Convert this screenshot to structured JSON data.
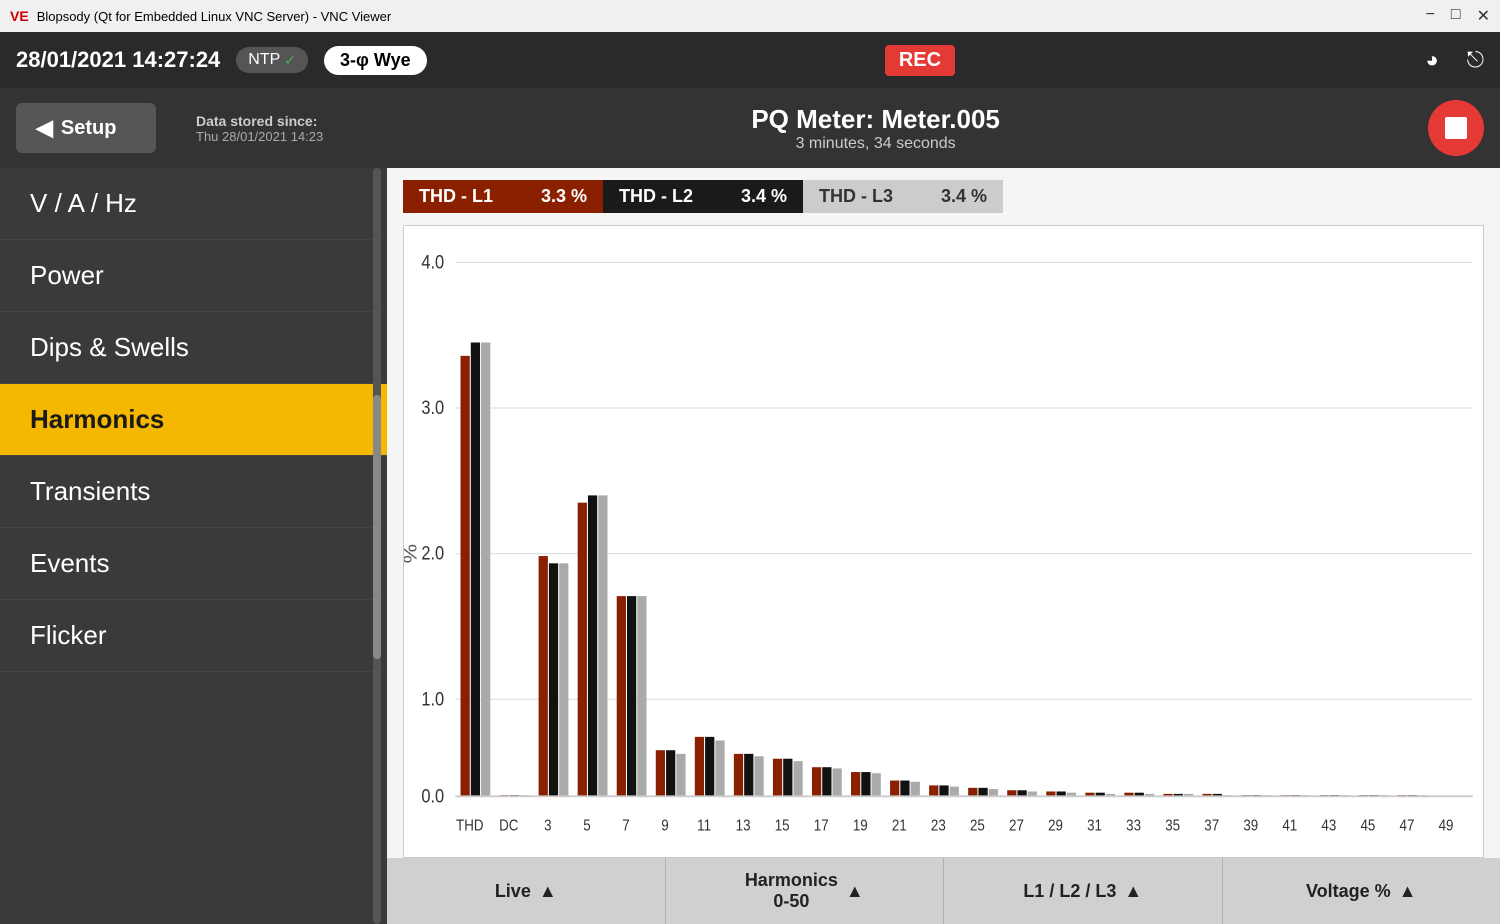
{
  "titlebar": {
    "title": "Blopsody (Qt for Embedded Linux VNC Server) - VNC Viewer",
    "icon_label": "VE"
  },
  "topbar": {
    "datetime": "28/01/2021  14:27:24",
    "ntp_label": "NTP",
    "wye_label": "3-φ Wye",
    "rec_label": "REC"
  },
  "headerbar": {
    "setup_label": "Setup",
    "meter_title": "PQ Meter: Meter.005",
    "data_stored_label": "Data stored since:",
    "data_stored_date": "Thu 28/01/2021 14:23",
    "duration": "3 minutes, 34 seconds"
  },
  "sidebar": {
    "items": [
      {
        "label": "V / A / Hz",
        "active": false
      },
      {
        "label": "Power",
        "active": false
      },
      {
        "label": "Dips & Swells",
        "active": false
      },
      {
        "label": "Harmonics",
        "active": true
      },
      {
        "label": "Transients",
        "active": false
      },
      {
        "label": "Events",
        "active": false
      },
      {
        "label": "Flicker",
        "active": false
      }
    ]
  },
  "thd": [
    {
      "label": "THD - L1",
      "value": "3.3",
      "unit": "%"
    },
    {
      "label": "THD - L2",
      "value": "3.4",
      "unit": "%"
    },
    {
      "label": "THD - L3",
      "value": "3.4",
      "unit": "%"
    }
  ],
  "chart": {
    "y_label": "%",
    "y_max": 4.0,
    "y_ticks": [
      0.0,
      1.0,
      2.0,
      3.0,
      4.0
    ],
    "x_labels": [
      "THD",
      "DC",
      "3",
      "5",
      "7",
      "9",
      "11",
      "13",
      "15",
      "17",
      "19",
      "21",
      "23",
      "25",
      "27",
      "29",
      "31",
      "33",
      "35",
      "37",
      "39",
      "41",
      "43",
      "45",
      "47",
      "49"
    ],
    "bars": {
      "l1": [
        3.3,
        0.0,
        1.8,
        2.2,
        1.5,
        0.35,
        0.45,
        0.32,
        0.28,
        0.22,
        0.18,
        0.12,
        0.08,
        0.06,
        0.05,
        0.04,
        0.03,
        0.03,
        0.02,
        0.02,
        0.02,
        0.01,
        0.01,
        0.01,
        0.01,
        0.01
      ],
      "l2": [
        3.4,
        0.0,
        1.75,
        2.25,
        1.5,
        0.35,
        0.45,
        0.32,
        0.28,
        0.22,
        0.18,
        0.12,
        0.08,
        0.06,
        0.05,
        0.04,
        0.03,
        0.03,
        0.02,
        0.02,
        0.02,
        0.01,
        0.01,
        0.01,
        0.01,
        0.01
      ],
      "l3": [
        3.4,
        0.0,
        1.75,
        2.25,
        1.5,
        0.3,
        0.42,
        0.3,
        0.26,
        0.2,
        0.17,
        0.11,
        0.07,
        0.05,
        0.04,
        0.03,
        0.02,
        0.02,
        0.02,
        0.01,
        0.01,
        0.01,
        0.01,
        0.01,
        0.01,
        0.01
      ]
    }
  },
  "bottombar": {
    "buttons": [
      {
        "label": "Live"
      },
      {
        "label": "Harmonics\n0-50"
      },
      {
        "label": "L1 / L2 / L3"
      },
      {
        "label": "Voltage %"
      }
    ]
  }
}
